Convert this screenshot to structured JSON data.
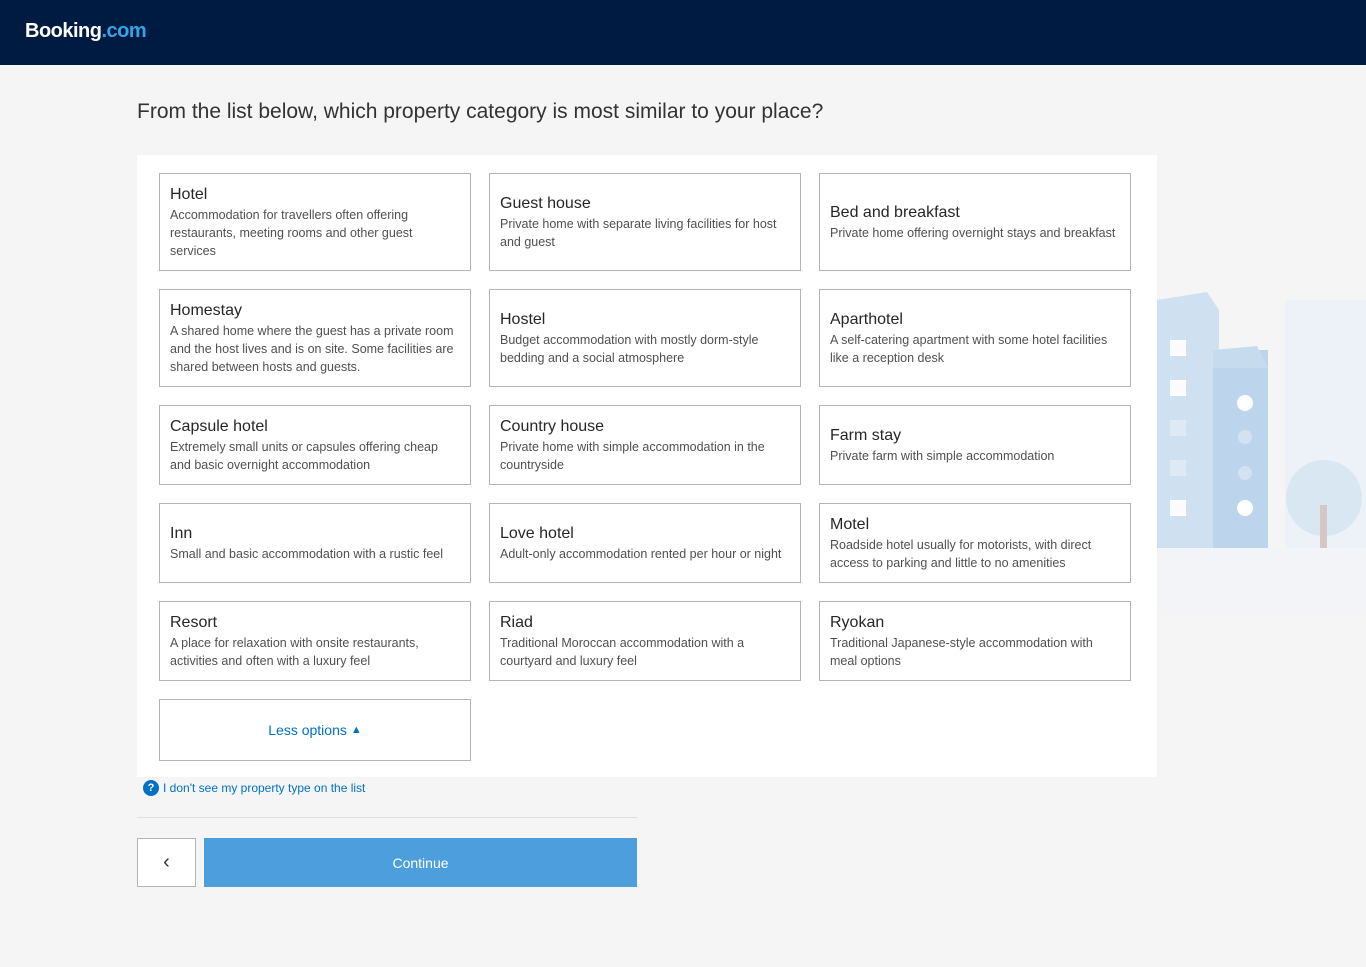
{
  "brand": {
    "name_main": "Booking",
    "name_suffix": ".com"
  },
  "question": "From the list below, which property category is most similar to your place?",
  "categories": [
    {
      "title": "Hotel",
      "desc": "Accommodation for travellers often offering restaurants, meeting rooms and other guest services"
    },
    {
      "title": "Guest house",
      "desc": "Private home with separate living facilities for host and guest"
    },
    {
      "title": "Bed and breakfast",
      "desc": "Private home offering overnight stays and breakfast"
    },
    {
      "title": "Homestay",
      "desc": "A shared home where the guest has a private room and the host lives and is on site. Some facilities are shared between hosts and guests."
    },
    {
      "title": "Hostel",
      "desc": "Budget accommodation with mostly dorm-style bedding and a social atmosphere"
    },
    {
      "title": "Aparthotel",
      "desc": "A self-catering apartment with some hotel facilities like a reception desk"
    },
    {
      "title": "Capsule hotel",
      "desc": "Extremely small units or capsules offering cheap and basic overnight accommodation"
    },
    {
      "title": "Country house",
      "desc": "Private home with simple accommodation in the countryside"
    },
    {
      "title": "Farm stay",
      "desc": "Private farm with simple accommodation"
    },
    {
      "title": "Inn",
      "desc": "Small and basic accommodation with a rustic feel"
    },
    {
      "title": "Love hotel",
      "desc": "Adult-only accommodation rented per hour or night"
    },
    {
      "title": "Motel",
      "desc": "Roadside hotel usually for motorists, with direct access to parking and little to no amenities"
    },
    {
      "title": "Resort",
      "desc": "A place for relaxation with onsite restaurants, activities and often with a luxury feel"
    },
    {
      "title": "Riad",
      "desc": "Traditional Moroccan accommodation with a courtyard and luxury feel"
    },
    {
      "title": "Ryokan",
      "desc": "Traditional Japanese-style accommodation with meal options"
    }
  ],
  "less_options_label": "Less options",
  "help_link": "I don't see my property type on the list",
  "help_icon": "?",
  "back_icon": "chevron-left-icon",
  "back_glyph": "‹",
  "continue_label": "Continue",
  "colors": {
    "header": "#001b42",
    "accent": "#0071c2",
    "continue": "#4c9fdc"
  }
}
